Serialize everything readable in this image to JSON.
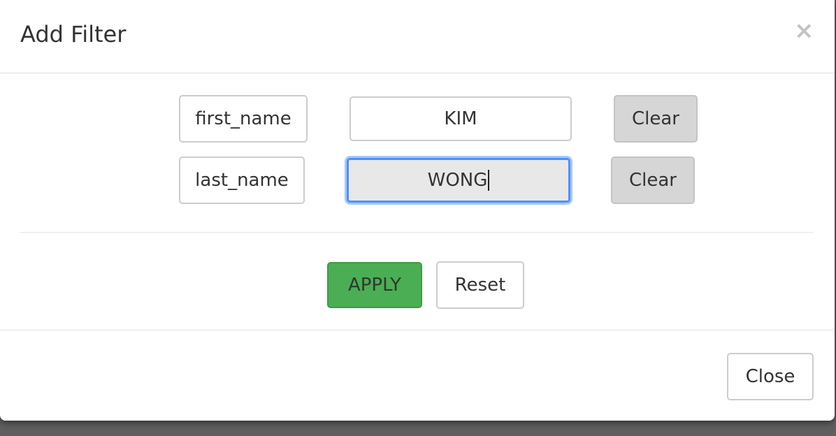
{
  "dialog": {
    "title": "Add Filter",
    "close_symbol": "×"
  },
  "filters": [
    {
      "field": "first_name",
      "value": "KIM",
      "clear_label": "Clear"
    },
    {
      "field": "last_name",
      "value": "WONG",
      "clear_label": "Clear",
      "focused": true
    }
  ],
  "actions": {
    "apply_label": "APPLY",
    "reset_label": "Reset"
  },
  "footer": {
    "close_label": "Close"
  },
  "colors": {
    "apply_green": "#4cae54",
    "focus_blue": "#4d90fe",
    "clear_gray": "#d6d6d6"
  }
}
